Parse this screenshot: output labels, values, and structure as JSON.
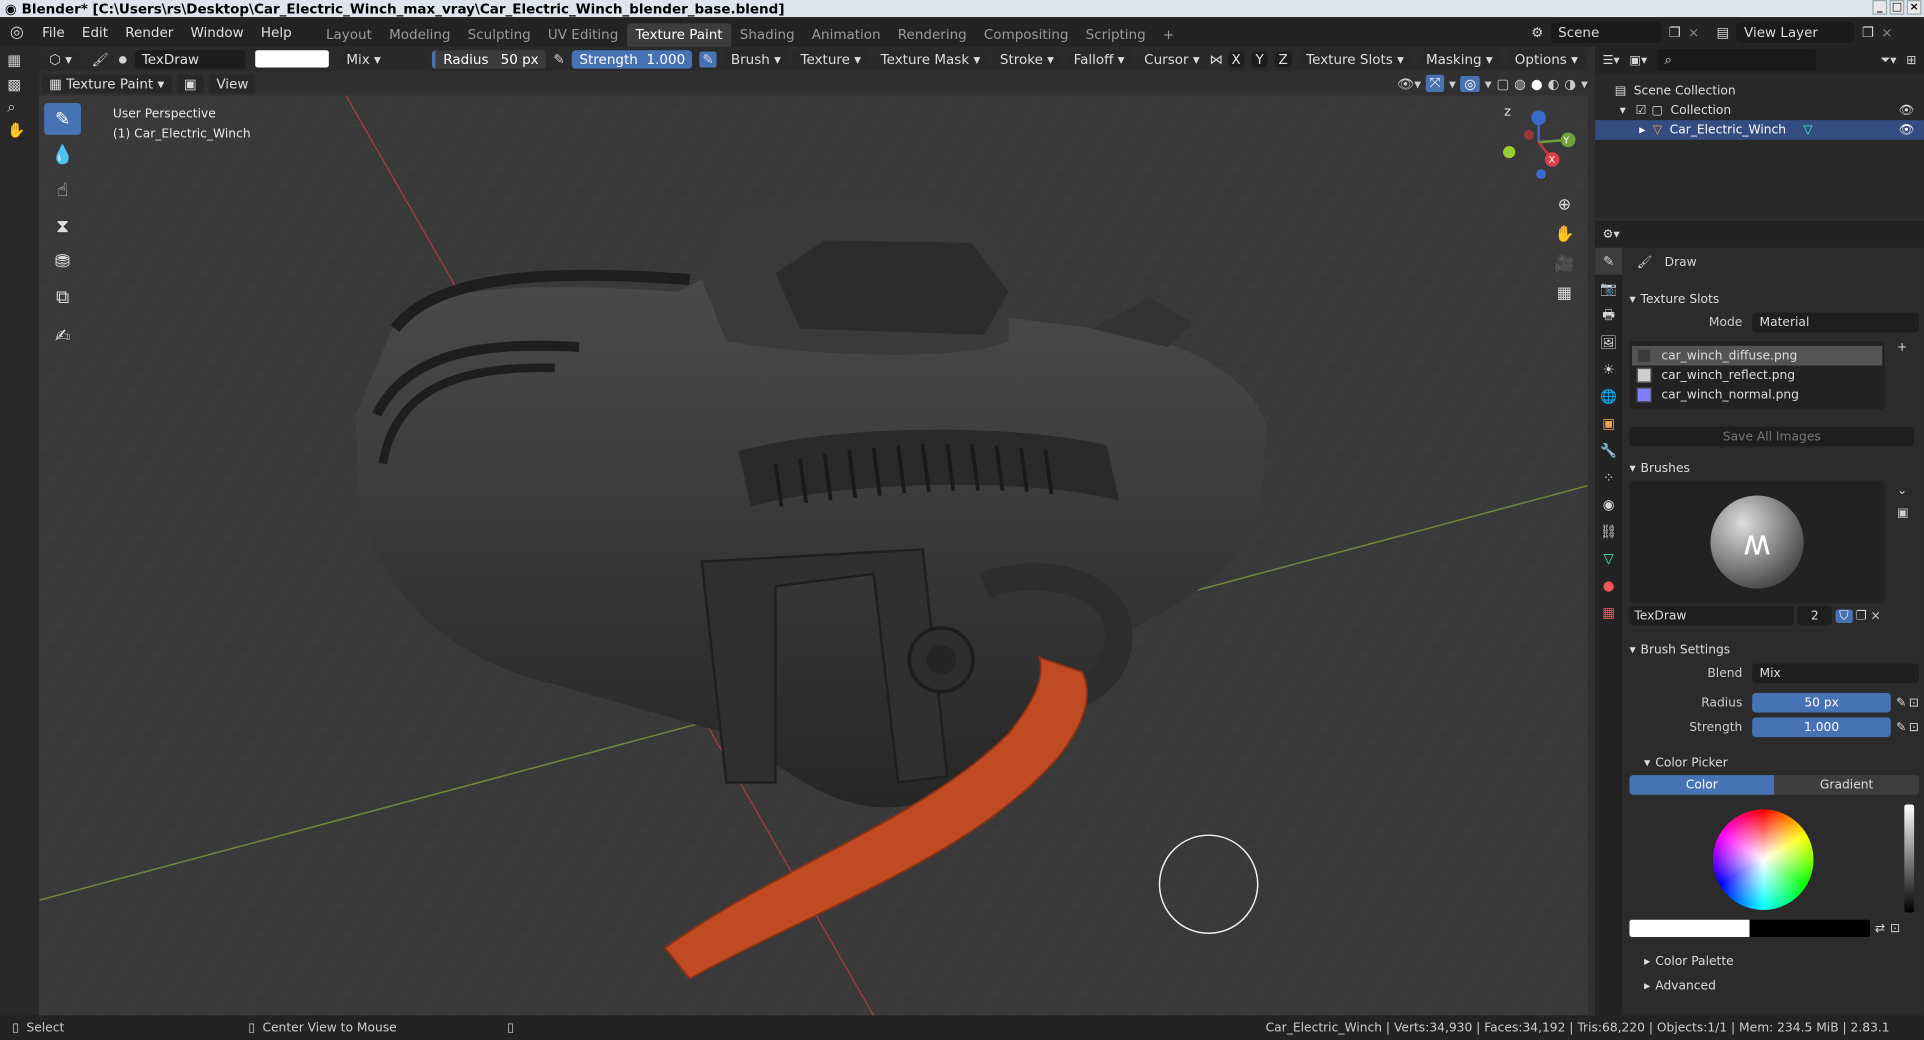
{
  "titlebar": {
    "title": "Blender* [C:\\Users\\rs\\Desktop\\Car_Electric_Winch_max_vray\\Car_Electric_Winch_blender_base.blend]"
  },
  "menus": [
    "File",
    "Edit",
    "Render",
    "Window",
    "Help"
  ],
  "workspaces": [
    "Layout",
    "Modeling",
    "Sculpting",
    "UV Editing",
    "Texture Paint",
    "Shading",
    "Animation",
    "Rendering",
    "Compositing",
    "Scripting"
  ],
  "active_workspace": "Texture Paint",
  "scene": {
    "scene_name": "Scene",
    "view_layer": "View Layer"
  },
  "header": {
    "brush_name": "TexDraw",
    "blend": "Mix",
    "radius_label": "Radius",
    "radius_value": "50 px",
    "strength_label": "Strength",
    "strength_value": "1.000",
    "menus": [
      "Brush",
      "Texture",
      "Texture Mask",
      "Stroke",
      "Falloff",
      "Cursor"
    ],
    "axes": [
      "X",
      "Y",
      "Z"
    ],
    "right_menus": [
      "Texture Slots",
      "Masking",
      "Options"
    ]
  },
  "subheader": {
    "mode": "Texture Paint",
    "view": "View"
  },
  "viewport": {
    "perspective": "User Perspective",
    "object": "(1) Car_Electric_Winch"
  },
  "gizmo": {
    "x": "X",
    "y": "Y",
    "z": "Z"
  },
  "outliner": {
    "scene_collection": "Scene Collection",
    "collection": "Collection",
    "object": "Car_Electric_Winch"
  },
  "properties": {
    "tool": "Draw",
    "texture_slots": {
      "title": "Texture Slots",
      "mode_label": "Mode",
      "mode_value": "Material",
      "slots": [
        {
          "name": "car_winch_diffuse.png",
          "color": "#3a3a3a"
        },
        {
          "name": "car_winch_reflect.png",
          "color": "#d0d0d0"
        },
        {
          "name": "car_winch_normal.png",
          "color": "#8080ff"
        }
      ],
      "save_all": "Save All Images"
    },
    "brushes": {
      "title": "Brushes",
      "brush_name": "TexDraw",
      "users": "2"
    },
    "brush_settings": {
      "title": "Brush Settings",
      "blend_label": "Blend",
      "blend_value": "Mix",
      "radius_label": "Radius",
      "radius_value": "50 px",
      "strength_label": "Strength",
      "strength_value": "1.000"
    },
    "color_picker": {
      "title": "Color Picker",
      "tab_color": "Color",
      "tab_gradient": "Gradient"
    },
    "color_palette": "Color Palette",
    "advanced": "Advanced"
  },
  "status": {
    "select": "Select",
    "center_view": "Center View to Mouse",
    "stats": "Car_Electric_Winch | Verts:34,930 | Faces:34,192 | Tris:68,220 | Objects:1/1 | Mem: 234.5 MiB | 2.83.1"
  },
  "colors": {
    "accent": "#4772b3",
    "strap": "#c04a22"
  }
}
